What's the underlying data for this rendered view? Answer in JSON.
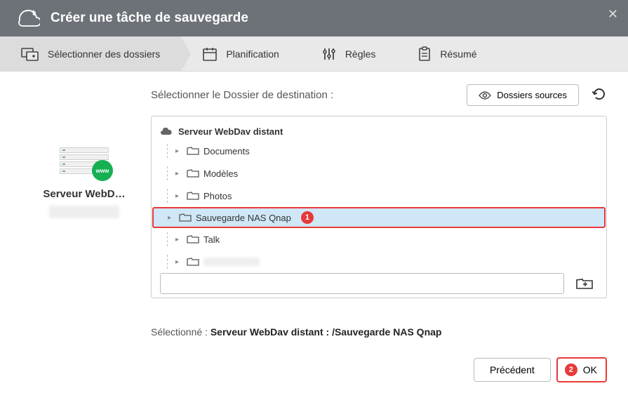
{
  "titlebar": {
    "title": "Créer une tâche de sauvegarde"
  },
  "steps": {
    "select": "Sélectionner des dossiers",
    "plan": "Planification",
    "rules": "Règles",
    "summary": "Résumé"
  },
  "left": {
    "server_name": "Serveur WebD…",
    "www_label": "www"
  },
  "top": {
    "label": "Sélectionner le Dossier de destination :",
    "sources_btn": "Dossiers sources"
  },
  "tree": {
    "root": "Serveur WebDav distant",
    "items": [
      {
        "label": "Documents"
      },
      {
        "label": "Modèles"
      },
      {
        "label": "Photos"
      },
      {
        "label": "Sauvegarde NAS Qnap",
        "selected": true,
        "badge": "1"
      },
      {
        "label": "Talk"
      },
      {
        "label": "",
        "obscured": true
      }
    ]
  },
  "selected": {
    "prefix": "Sélectionné : ",
    "path": "Serveur WebDav distant : /Sauvegarde NAS Qnap"
  },
  "footer": {
    "prev": "Précédent",
    "ok": "OK",
    "ok_badge": "2"
  }
}
